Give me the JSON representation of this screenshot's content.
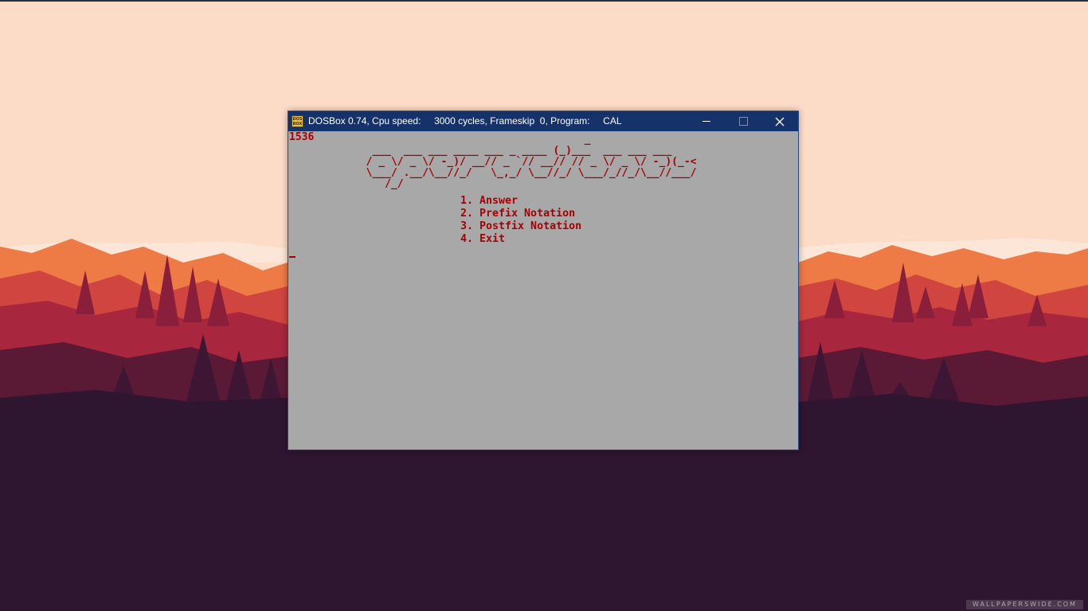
{
  "desktop": {
    "watermark_text": "WALLPAPERSWIDE.COM",
    "colors": {
      "sky": "#fddcc7",
      "mountain_far": "#e8623a",
      "mountain_mid": "#b8283e",
      "mountain_near": "#7a1e3c",
      "forest_floor": "#2e1530"
    }
  },
  "window": {
    "icon_name": "dosbox-icon",
    "icon_text": "DOS BOX",
    "title": "DOSBox 0.74, Cpu speed:     3000 cycles, Frameskip  0, Program:     CAL",
    "titlebar_color": "#15336a",
    "buttons": {
      "minimize": "minimize-icon",
      "maximize": "maximize-icon",
      "close": "close-icon"
    }
  },
  "dos_screen": {
    "background_color": "#a8a8a8",
    "text_color": "#a80000",
    "counter": "1536",
    "ascii_banner": "                                     _\n   ___  ___ ___ ____ ___ _ ____ (_)___  ___ ___ ___\n  / _ \\/ _ \\/ -_)/ __// _ `// __// // _ \\/ _ \\/ -_)(_-<\n  \\___/ .__/\\__//_/   \\_,_/ \\__//_/ \\___/_//_/\\__//___/\n     /_/",
    "menu": [
      {
        "label": "1. Answer"
      },
      {
        "label": "2. Prefix Notation"
      },
      {
        "label": "3. Postfix Notation"
      },
      {
        "label": "4. Exit"
      }
    ]
  }
}
